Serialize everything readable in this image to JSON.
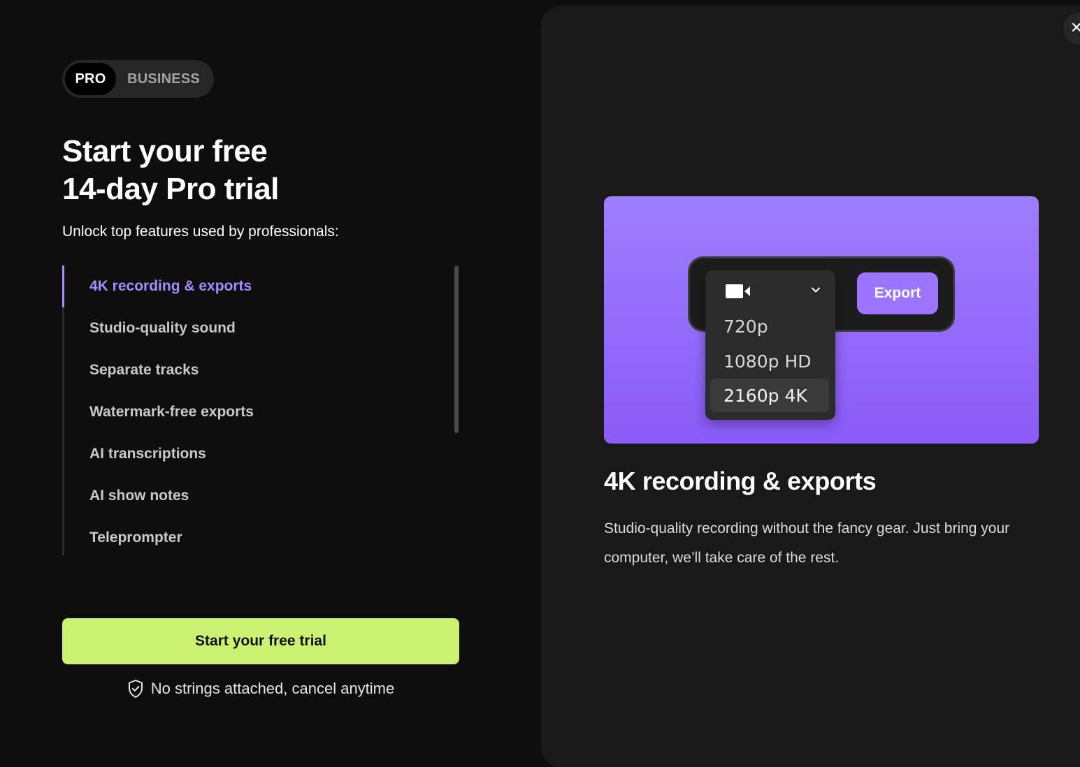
{
  "plan_toggle": {
    "options": [
      "PRO",
      "BUSINESS"
    ],
    "selected": "PRO"
  },
  "headline": {
    "line1": "Start your free",
    "line2": "14-day Pro trial"
  },
  "subhead": "Unlock top features used by professionals:",
  "features": [
    "4K recording & exports",
    "Studio-quality sound",
    "Separate tracks",
    "Watermark-free exports",
    "AI transcriptions",
    "AI show notes",
    "Teleprompter"
  ],
  "active_feature_index": 0,
  "cta": {
    "label": "Start your free trial",
    "reassurance": "No strings attached, cancel anytime"
  },
  "detail": {
    "title": "4K recording & exports",
    "description": "Studio-quality recording without the fancy gear. Just bring your computer, we’ll take care of the rest."
  },
  "illustration": {
    "export_label": "Export",
    "resolutions": [
      "720p",
      "1080p HD",
      "2160p 4K"
    ],
    "selected_resolution": "2160p 4K"
  },
  "icons": {
    "close": "close-icon",
    "shield": "shield-check-icon",
    "camera": "video-camera-icon",
    "chevron": "chevron-down-icon"
  },
  "colors": {
    "accent_purple": "#a98bff",
    "cta_green": "#ccf274",
    "card_gradient_top": "#9e7dff",
    "card_gradient_bottom": "#8a5cf8"
  }
}
